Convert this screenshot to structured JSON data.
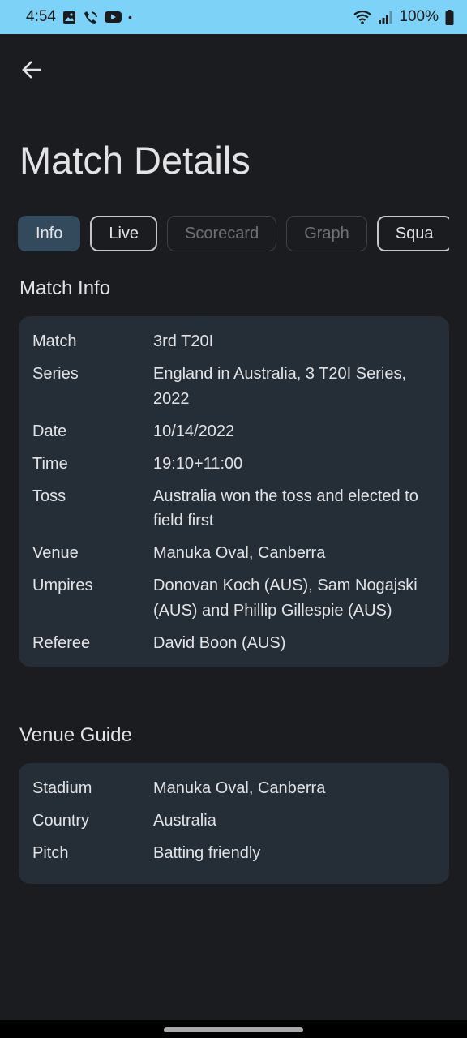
{
  "status_bar": {
    "time": "4:54",
    "dot": "•",
    "battery": "100%",
    "icons": [
      "image-icon",
      "wifi-calling-icon",
      "youtube-icon",
      "wifi-icon",
      "signal-icon",
      "battery-icon"
    ]
  },
  "header": {
    "back_icon": "arrow-back-icon",
    "title": "Match Details"
  },
  "tabs": [
    {
      "label": "Info",
      "state": "selected"
    },
    {
      "label": "Live",
      "state": "enabled"
    },
    {
      "label": "Scorecard",
      "state": "disabled"
    },
    {
      "label": "Graph",
      "state": "disabled"
    },
    {
      "label": "Squa",
      "state": "enabled"
    }
  ],
  "match_info": {
    "title": "Match Info",
    "rows": [
      {
        "label": "Match",
        "value": "3rd T20I"
      },
      {
        "label": "Series",
        "value": "England in Australia, 3 T20I Series, 2022"
      },
      {
        "label": "Date",
        "value": "10/14/2022"
      },
      {
        "label": "Time",
        "value": "19:10+11:00"
      },
      {
        "label": "Toss",
        "value": "Australia won the toss and elected to field first"
      },
      {
        "label": "Venue",
        "value": "Manuka Oval, Canberra"
      },
      {
        "label": "Umpires",
        "value": "Donovan Koch (AUS), Sam Nogajski (AUS) and Phillip Gillespie (AUS)"
      },
      {
        "label": "Referee",
        "value": "David Boon (AUS)"
      }
    ]
  },
  "venue_guide": {
    "title": "Venue Guide",
    "rows": [
      {
        "label": "Stadium",
        "value": "Manuka Oval, Canberra"
      },
      {
        "label": "Country",
        "value": "Australia"
      },
      {
        "label": "Pitch",
        "value": "Batting friendly"
      }
    ]
  },
  "colors": {
    "background": "#1b1c1f",
    "status_bar": "#7dd3f7",
    "card": "#252e37",
    "selected_tab": "#33495c"
  }
}
